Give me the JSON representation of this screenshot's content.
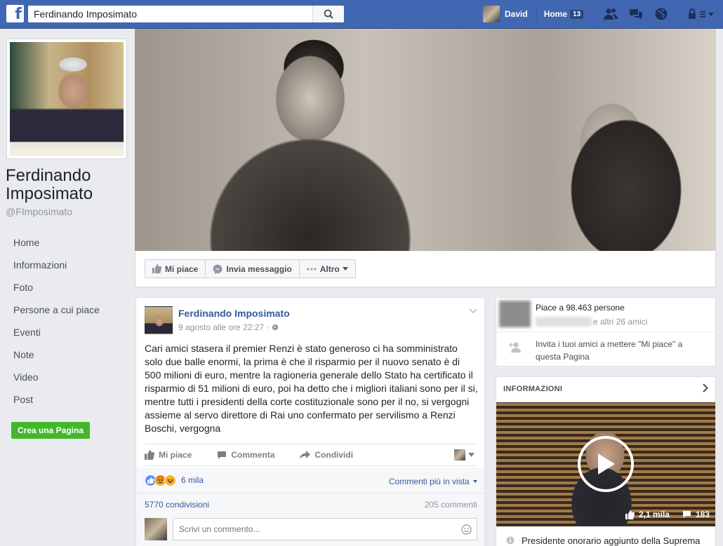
{
  "topbar": {
    "logo": "f",
    "search_value": "Ferdinando Imposimato",
    "user_name": "David",
    "home_label": "Home",
    "home_count": "13"
  },
  "profile": {
    "name": "Ferdinando Imposimato",
    "handle": "@FImposimato"
  },
  "left_nav": {
    "items": [
      {
        "label": "Home"
      },
      {
        "label": "Informazioni"
      },
      {
        "label": "Foto"
      },
      {
        "label": "Persone a cui piace"
      },
      {
        "label": "Eventi"
      },
      {
        "label": "Note"
      },
      {
        "label": "Video"
      },
      {
        "label": "Post"
      }
    ],
    "create_page": "Crea una Pagina"
  },
  "cover_actions": {
    "like": "Mi piace",
    "message": "Invia messaggio",
    "more": "Altro"
  },
  "post": {
    "author": "Ferdinando Imposimato",
    "time": "9 agosto alle ore 22:27",
    "text": "Cari amici stasera il premier Renzi è stato generoso ci ha somministrato solo due balle enormi, la prima è che il risparmio per il nuovo senato è di 500 milioni di euro, mentre la ragioneria generale dello Stato ha certificato il risparmio di 51 milioni di euro, poi ha detto che i migliori italiani sono per il si, mentre tutti i presidenti della corte costituzionale sono per il no, si vergogni assieme al servo direttore di Rai uno confermato per servilismo a Renzi Boschi, vergogna",
    "action_like": "Mi piace",
    "action_comment": "Commenta",
    "action_share": "Condividi",
    "reactions_count": "6 mila",
    "comments_view": "Commenti più in vista",
    "shares": "5770 condivisioni",
    "comments": "205 commenti",
    "comment_placeholder": "Scrivi un commento..."
  },
  "likes_box": {
    "likes_text": "Piace a 98.463 persone",
    "friends_text": "e altri 26 amici",
    "invite_text": "Invita i tuoi amici a mettere \"Mi piace\" a questa Pagina"
  },
  "info_box": {
    "title": "INFORMAZIONI",
    "video_likes": "2,1 mila",
    "video_comments": "183",
    "description": "Presidente onorario aggiunto della Suprema"
  },
  "colors": {
    "topbar": "#4267b2",
    "link": "#365899",
    "create_button": "#42b72a"
  }
}
